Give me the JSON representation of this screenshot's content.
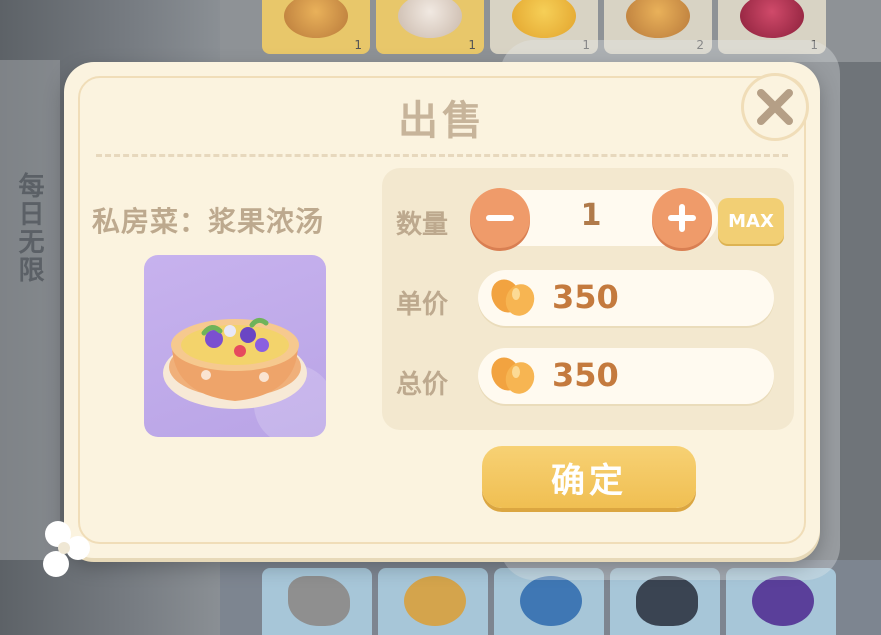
{
  "background": {
    "side_text": "每日无限",
    "top_slots": [
      {
        "count": "1",
        "gold": true
      },
      {
        "count": "1",
        "gold": true
      },
      {
        "count": "1",
        "gold": false
      },
      {
        "count": "2",
        "gold": false
      },
      {
        "count": "1",
        "gold": false
      }
    ]
  },
  "dialog": {
    "title": "出售",
    "close_icon": "close-icon",
    "item": {
      "name": "私房菜：浆果浓汤",
      "image_icon": "berry-soup-icon"
    },
    "form": {
      "quantity_label": "数量",
      "quantity_value": "1",
      "max_label": "MAX",
      "unit_price_label": "单价",
      "unit_price_value": "350",
      "total_price_label": "总价",
      "total_price_value": "350",
      "currency_icon": "bean-coin-icon"
    },
    "confirm_label": "确定"
  },
  "colors": {
    "dialog_bg": "#fbf3df",
    "accent_orange": "#ef9b6a",
    "confirm_gold": "#f0bf52",
    "label_tan": "#bda98e",
    "price_text": "#c47a3e"
  }
}
